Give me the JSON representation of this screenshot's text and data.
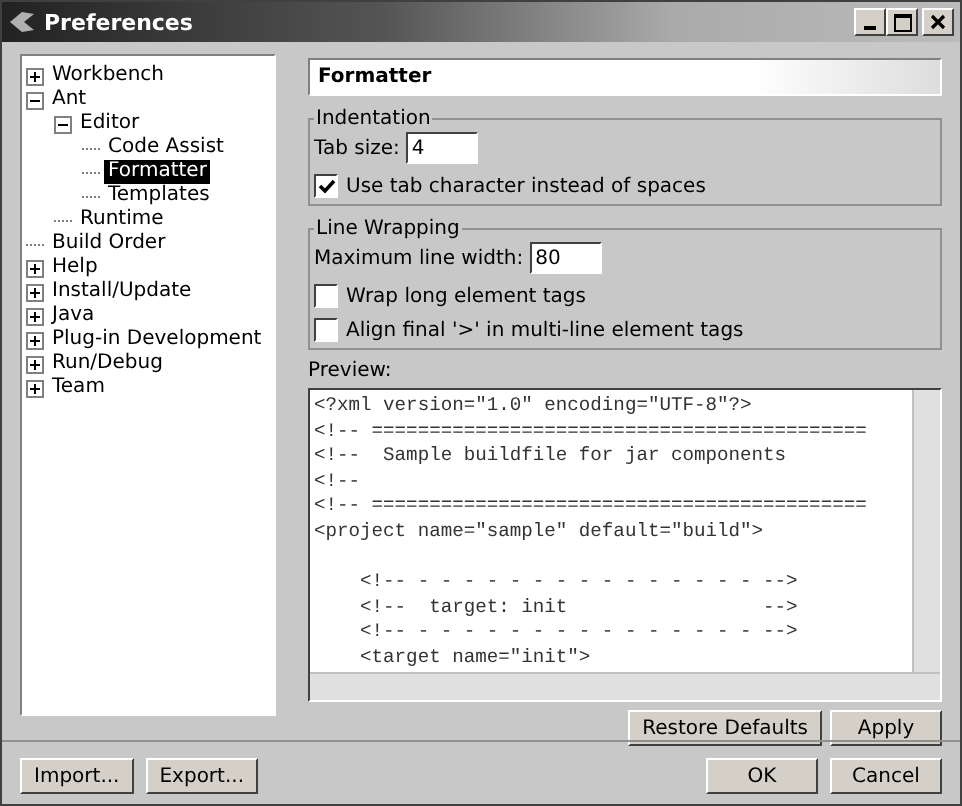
{
  "window": {
    "title": "Preferences"
  },
  "tree": [
    {
      "label": "Workbench",
      "expanded": false
    },
    {
      "label": "Ant",
      "expanded": true,
      "selected": false,
      "children": [
        {
          "label": "Editor",
          "expanded": true,
          "selected": false,
          "children": [
            {
              "label": "Code Assist",
              "selected": false
            },
            {
              "label": "Formatter",
              "selected": true
            },
            {
              "label": "Templates",
              "selected": false
            }
          ]
        },
        {
          "label": "Runtime",
          "selected": false
        }
      ]
    },
    {
      "label": "Build Order",
      "selected": false
    },
    {
      "label": "Help",
      "expanded": false
    },
    {
      "label": "Install/Update",
      "expanded": false
    },
    {
      "label": "Java",
      "expanded": false
    },
    {
      "label": "Plug-in Development",
      "expanded": false
    },
    {
      "label": "Run/Debug",
      "expanded": false
    },
    {
      "label": "Team",
      "expanded": false
    }
  ],
  "page": {
    "title": "Formatter",
    "groups": [
      {
        "title": "Indentation",
        "field": {
          "label": "Tab size:",
          "value": "4"
        },
        "checkboxes": [
          {
            "label": "Use tab character instead of spaces",
            "checked": true
          }
        ]
      },
      {
        "title": "Line Wrapping",
        "field": {
          "label": "Maximum line width:",
          "value": "80"
        },
        "checkboxes": [
          {
            "label": "Wrap long element tags",
            "checked": false
          },
          {
            "label": "Align final '>' in multi-line element tags",
            "checked": false
          }
        ]
      }
    ],
    "preview": {
      "label": "Preview:",
      "blocks": [
        [
          "<?xml version=\"1.0\" encoding=\"UTF-8\"?>",
          "<!-- ===========================================",
          "<!--  Sample buildfile for jar components",
          "<!--",
          "<!-- ===========================================",
          "<project name=\"sample\" default=\"build\">"
        ],
        [
          "    <!-- - - - - - - - - - - - - - - - -->",
          "    <!--  target: init                 -->",
          "    <!-- - - - - - - - - - - - - - - - -->",
          "    <target name=\"init\">"
        ]
      ]
    },
    "buttons": [
      "Restore Defaults",
      "Apply"
    ]
  },
  "footer": {
    "left_buttons": [
      "Import...",
      "Export..."
    ],
    "right_buttons": [
      "OK",
      "Cancel"
    ]
  }
}
